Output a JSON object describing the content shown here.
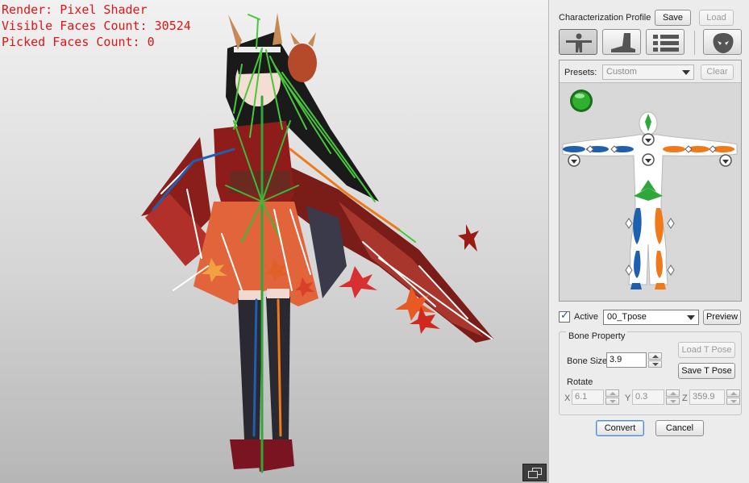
{
  "viewport": {
    "overlay": {
      "render": "Render: Pixel Shader",
      "visible_faces": "Visible Faces Count: 30524",
      "picked_faces": "Picked Faces Count: 0"
    },
    "toggle_icon": "restore-window-icon"
  },
  "panel": {
    "profile_label": "Characterization Profile",
    "save_label": "Save",
    "load_label": "Load",
    "tabs": [
      {
        "icon": "body-icon",
        "active": true
      },
      {
        "icon": "foot-icon",
        "active": false
      },
      {
        "icon": "list-icon",
        "active": false
      },
      {
        "icon": "mask-icon",
        "active": false
      }
    ],
    "presets_label": "Presets:",
    "presets_value": "Custom",
    "clear_label": "Clear",
    "active_label": "Active",
    "active_checked": true,
    "pose_value": "00_Tpose",
    "preview_label": "Preview",
    "bone_property": {
      "title": "Bone Property",
      "bone_size_label": "Bone Size",
      "bone_size": "3.9",
      "load_tpose_label": "Load T Pose",
      "save_tpose_label": "Save T Pose",
      "rotate_label": "Rotate",
      "x_label": "X",
      "x_value": "6.1",
      "y_label": "Y",
      "y_value": "0.3",
      "z_label": "Z",
      "z_value": "359.9"
    },
    "convert_label": "Convert",
    "cancel_label": "Cancel"
  },
  "colors": {
    "overlay_text": "#e01515",
    "left_limb": "#1f5fb0",
    "right_limb": "#f07a1a",
    "spine": "#2fa83a",
    "status_indicator": "#1f9d1f"
  }
}
